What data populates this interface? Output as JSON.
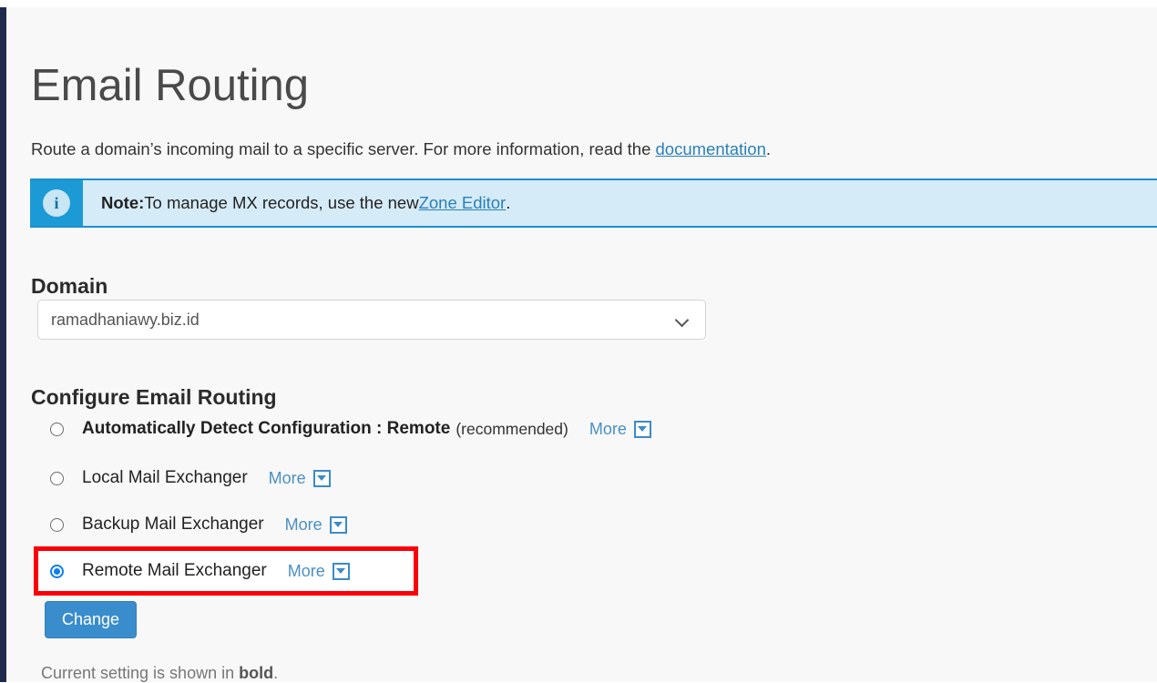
{
  "page": {
    "title": "Email Routing",
    "intro_before": "Route a domain’s incoming mail to a specific server. For more information, read the ",
    "intro_link": "documentation",
    "intro_after": "."
  },
  "note": {
    "icon": "info-icon",
    "icon_glyph": "i",
    "label": "Note:",
    "text_before": " To manage MX records, use the new ",
    "link": "Zone Editor",
    "text_after": "."
  },
  "domain": {
    "heading": "Domain",
    "selected": "ramadhaniawy.biz.id",
    "options": [
      "ramadhaniawy.biz.id"
    ]
  },
  "configure": {
    "heading": "Configure Email Routing",
    "more_label": "More",
    "options": [
      {
        "label": "Automatically Detect Configuration : Remote",
        "suffix": "(recommended)",
        "bold": true,
        "checked": false
      },
      {
        "label": "Local Mail Exchanger",
        "suffix": "",
        "bold": false,
        "checked": false
      },
      {
        "label": "Backup Mail Exchanger",
        "suffix": "",
        "bold": false,
        "checked": false
      },
      {
        "label": "Remote Mail Exchanger",
        "suffix": "",
        "bold": false,
        "checked": true
      }
    ]
  },
  "actions": {
    "change_label": "Change",
    "footnote_before": "Current setting is shown in ",
    "footnote_bold": "bold",
    "footnote_after": "."
  },
  "colors": {
    "accent_blue": "#3a8dcc",
    "link_blue": "#2980b9",
    "note_border": "#1b8fd0",
    "note_bg": "#d6ebf8",
    "note_icon_bg": "#1b9ad6",
    "radio_checked": "#0a7ff2",
    "highlight_red": "#fb0007",
    "nav_rail": "#1f2a4d",
    "page_bg": "#f8f8f8"
  }
}
